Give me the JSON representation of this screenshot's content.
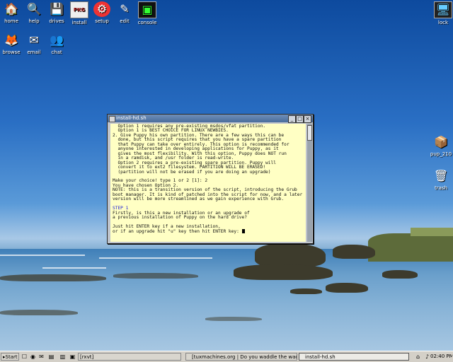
{
  "desktop_icons_top": [
    {
      "label": "home",
      "glyph": "🏠"
    },
    {
      "label": "help",
      "glyph": "🔍"
    },
    {
      "label": "drives",
      "glyph": "💾"
    },
    {
      "label": "install",
      "glyph": "PKG"
    },
    {
      "label": "setup",
      "glyph": "⚙"
    },
    {
      "label": "edit",
      "glyph": "✎"
    },
    {
      "label": "console",
      "glyph": "▣"
    }
  ],
  "desktop_icons_second": [
    {
      "label": "browse",
      "glyph": "🦊"
    },
    {
      "label": "email",
      "glyph": "✉"
    },
    {
      "label": "chat",
      "glyph": "👥"
    }
  ],
  "desktop_icons_right": [
    {
      "label": "lock",
      "glyph": "🖥"
    },
    {
      "label": "pup_210",
      "glyph": "📦"
    },
    {
      "label": "trash",
      "glyph": "🗑"
    }
  ],
  "terminal": {
    "title": "install-hd.sh",
    "lines": [
      "  Option 1 requires any pre-existing msdos/vfat partition.",
      "  Option 1 is BEST CHOICE FOR LINUX NEWBIES.",
      "2. Give Puppy his own partition. There are a few ways this can be",
      "  done, but this script requires that you have a spare partition",
      "  that Puppy can take over entirely. This option is recommended for",
      "  anyone interested in developing applications for Puppy, as it",
      "  gives the most flexibility. With this option, Puppy does NOT run",
      "  in a ramdisk, and /usr folder is read-write.",
      "  Option 2 requires a pre-existing spare partition. Puppy will",
      "  convert it to ext2 filesystem. PARTITION WILL BE ERASED!",
      "  (partition will not be erased if you are doing an upgrade)",
      "",
      "Make your choice! type 1 or 2 [1]: 2",
      "You have chosen Option 2.",
      "NOTE: this is a transition version of the script, introducing the Grub",
      "boot manager. It is kind of patched into the script for now, and a later",
      "version will be more streamlined as we gain experience with Grub.",
      ""
    ],
    "step_label": "STEP 1",
    "lines_after": [
      "Firstly, is this a new installation or an upgrade of",
      "a previous installation of Puppy on the hard drive?",
      "",
      "Just hit ENTER key if a new installation,"
    ],
    "prompt": "or if an upgrade hit \"u\" key then hit ENTER key: "
  },
  "taskbar": {
    "start_label": "Start",
    "tasks": [
      {
        "label": "[rxvt]"
      },
      {
        "label": "[tuxmachines.org | Do you waddle the waddle? - Mozil"
      },
      {
        "label": "install-hd.sh"
      }
    ],
    "clock": "02:40 PM"
  }
}
